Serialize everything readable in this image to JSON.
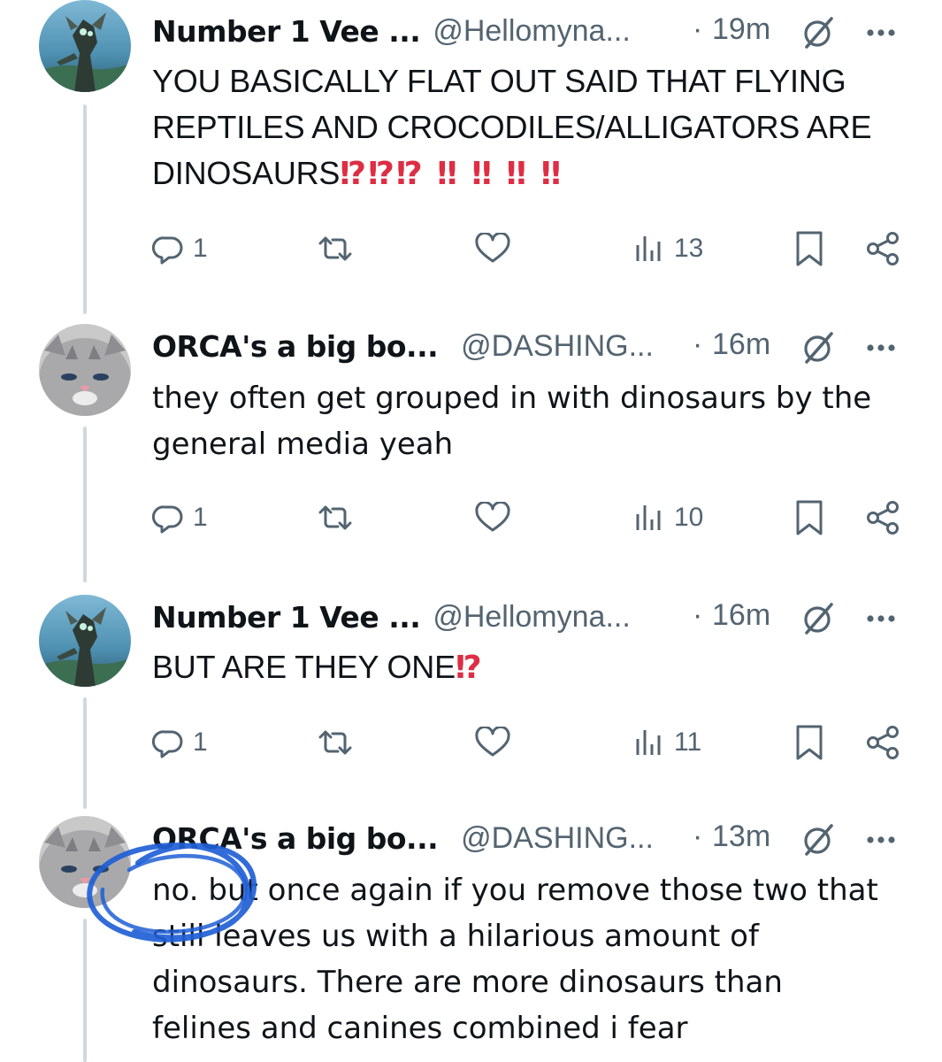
{
  "tweets": [
    {
      "display_name": "Number 1 Vee ...",
      "handle": "@Hellomyna...",
      "dot": "·",
      "time": "19m",
      "text_main": "YOU BASICALLY FLAT OUT SAID THAT FLYING\nREPTILES AND CROCODILES/ALLIGATORS ARE\nDINOSAURS",
      "text_emph": "⁉⁉⁉ ‼ ‼ ‼ ‼",
      "replies": "1",
      "reposts": "",
      "likes": "",
      "views": "13",
      "avatar": "mech-robot-avatar"
    },
    {
      "display_name": "ORCA's a big bo...",
      "handle": "@DASHING...",
      "dot": "·",
      "time": "16m",
      "text_main": "they often get grouped in with dinosaurs by the\ngeneral media yeah",
      "text_emph": "",
      "replies": "1",
      "reposts": "",
      "likes": "",
      "views": "10",
      "avatar": "kitten-avatar"
    },
    {
      "display_name": "Number 1 Vee ...",
      "handle": "@Hellomyna...",
      "dot": "·",
      "time": "16m",
      "text_main": "BUT ARE THEY ONE",
      "text_emph": "⁉",
      "replies": "1",
      "reposts": "",
      "likes": "",
      "views": "11",
      "avatar": "mech-robot-avatar"
    },
    {
      "display_name": "ORCA's a big bo...",
      "handle": "@DASHING...",
      "dot": "·",
      "time": "13m",
      "text_main": "no. but once again if you remove those two that\nstill leaves us with a hilarious amount of\ndinosaurs. There are more dinosaurs than\nfelines and canines combined i fear",
      "text_emph": "",
      "avatar": "kitten-avatar"
    }
  ],
  "icons": {
    "reply": "reply-icon",
    "repost": "repost-icon",
    "like": "heart-icon",
    "views": "views-icon",
    "bookmark": "bookmark-icon",
    "share": "share-icon",
    "grok": "grok-icon",
    "more": "more-icon"
  },
  "colors": {
    "text": "#0f1419",
    "secondary": "#536471",
    "thread_line": "#cfd9de",
    "emphasis_red": "#dd2e44",
    "annotation_blue": "#1f5fd6"
  }
}
